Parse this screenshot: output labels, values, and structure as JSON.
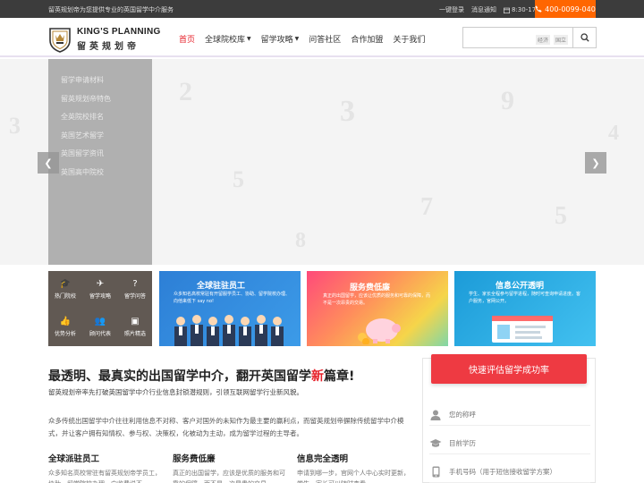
{
  "topbar": {
    "slogan": "留英规划帝为您提供专业的英国留学中介服务",
    "login": "一键登录",
    "notice": "消息通知",
    "hours": "8:30-17:30",
    "phone": "400-0099-040"
  },
  "header": {
    "brand_en": "KING'S PLANNING",
    "brand_cn": "留英规划帝",
    "nav": [
      {
        "label": "首页",
        "active": true,
        "dropdown": false
      },
      {
        "label": "全球院校库",
        "active": false,
        "dropdown": true
      },
      {
        "label": "留学攻略",
        "active": false,
        "dropdown": true
      },
      {
        "label": "问答社区",
        "active": false,
        "dropdown": false
      },
      {
        "label": "合作加盟",
        "active": false,
        "dropdown": false
      },
      {
        "label": "关于我们",
        "active": false,
        "dropdown": false
      }
    ],
    "search": {
      "placeholder": "",
      "tag1": "经济",
      "tag2": "国立"
    }
  },
  "hero": {
    "menu": [
      "留学申请材料",
      "留英规划帝特色",
      "全英院校排名",
      "英国艺术留学",
      "英国留学资讯",
      "英国高中院校"
    ]
  },
  "quick": [
    {
      "icon": "graduation-cap-icon",
      "label": "热门院校"
    },
    {
      "icon": "plane-icon",
      "label": "留学攻略"
    },
    {
      "icon": "question-icon",
      "label": "留学问答"
    },
    {
      "icon": "thumbs-up-icon",
      "label": "优势分析"
    },
    {
      "icon": "users-icon",
      "label": "顾问代表"
    },
    {
      "icon": "image-icon",
      "label": "照片精选"
    }
  ],
  "banners": [
    {
      "title": "全球驻驻员工",
      "text": "众多知名高校常驻有开留服学员工、协助、留学院校办理、向他来低下 say no!"
    },
    {
      "title": "服务费低廉",
      "text": "真正的出国留学，应该让优质的服务和可靠的保障，而不是一次昂贵的交易。"
    },
    {
      "title": "信息公开透明",
      "text": "学生、家长全程参与留学进程，随时可查询申请进度。客户服务，官网公开。"
    }
  ],
  "intro": {
    "title_a": "最透明、最真实的出国留学中介，翻开英国留学",
    "title_hl": "新",
    "title_b": "篇章!",
    "subtitle": "留英规划帝率先打破英国留学中介行业信息封锁潜规则，引领互联网留学行业新风貌。",
    "body": "众多传统出国留学中介往往利用信息不对称、客户对国外的未知作为最主要的赢利点，而留英规划帝摒除传统留学中介模式，并让客户拥有知情权、参与权、决策权，化被动为主动，成为留学过程的主导者。",
    "features": [
      {
        "title": "全球派驻员工",
        "text": "众多知名高校常驻有留英规划帝学员工，协助、留学院校办理，向收费说不"
      },
      {
        "title": "服务费低廉",
        "text": "真正的出国留学，应该是优质的服务和可靠的保障，而不是一次昂贵的交易"
      },
      {
        "title": "信息完全透明",
        "text": "申请到哪一步，官网个人中心实时更新，学生、家长可以随时查看"
      }
    ]
  },
  "form": {
    "button": "快速评估留学成功率",
    "name_ph": "您的称呼",
    "edu_ph": "目前学历",
    "phone_ph": "手机号码（用于短信接收留学方案）"
  },
  "colors": {
    "accent": "#e6212a",
    "phone_bg": "#ff6600",
    "topbar_bg": "#3c3c3c",
    "eval_btn": "#ee3a42"
  }
}
